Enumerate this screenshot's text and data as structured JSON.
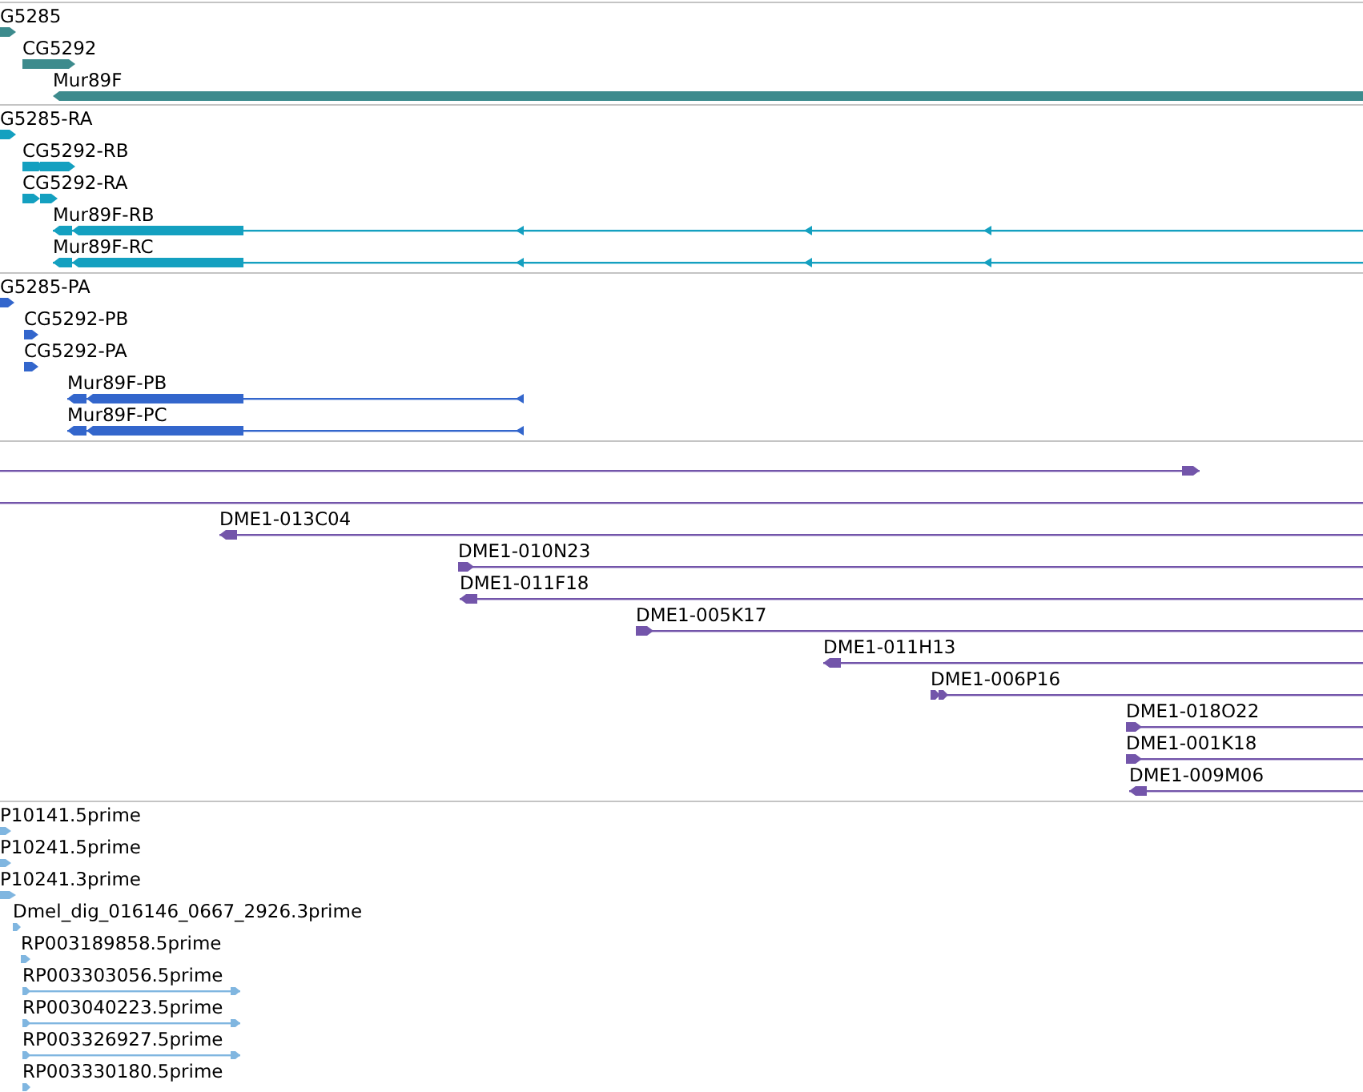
{
  "tracks": [
    {
      "color": "#3d8b8d",
      "features": [
        {
          "label": "G5285",
          "reverse": false
        },
        {
          "label": "CG5292",
          "reverse": false
        },
        {
          "label": "Mur89F",
          "reverse": true
        }
      ]
    },
    {
      "color": "#14a0c0",
      "features": [
        {
          "label": "G5285-RA",
          "reverse": false
        },
        {
          "label": "CG5292-RB",
          "reverse": false
        },
        {
          "label": "CG5292-RA",
          "reverse": false
        },
        {
          "label": "Mur89F-RB",
          "reverse": true
        },
        {
          "label": "Mur89F-RC",
          "reverse": true
        }
      ]
    },
    {
      "color": "#3366cc",
      "features": [
        {
          "label": "G5285-PA",
          "reverse": false
        },
        {
          "label": "CG5292-PB",
          "reverse": false
        },
        {
          "label": "CG5292-PA",
          "reverse": false
        },
        {
          "label": "Mur89F-PB",
          "reverse": true
        },
        {
          "label": "Mur89F-PC",
          "reverse": true
        }
      ]
    },
    {
      "color": "#7355aa",
      "features": [
        {
          "reverse": false
        },
        {
          "reverse": false
        },
        {
          "label": "DME1-013C04",
          "reverse": true
        },
        {
          "label": "DME1-010N23",
          "reverse": false
        },
        {
          "label": "DME1-011F18",
          "reverse": true
        },
        {
          "label": "DME1-005K17",
          "reverse": false
        },
        {
          "label": "DME1-011H13",
          "reverse": true
        },
        {
          "label": "DME1-006P16",
          "reverse": false
        },
        {
          "label": "DME1-018O22",
          "reverse": false
        },
        {
          "label": "DME1-001K18",
          "reverse": false
        },
        {
          "label": "DME1-009M06",
          "reverse": true
        }
      ]
    },
    {
      "color": "#80b6e0",
      "features": [
        {
          "label": "P10141.5prime",
          "reverse": false
        },
        {
          "label": "P10241.5prime",
          "reverse": false
        },
        {
          "label": "P10241.3prime",
          "reverse": false
        },
        {
          "label": "Dmel_dig_016146_0667_2926.3prime",
          "reverse": false
        },
        {
          "label": "RP003189858.5prime",
          "reverse": false
        },
        {
          "label": "RP003303056.5prime",
          "reverse": false
        },
        {
          "label": "RP003040223.5prime",
          "reverse": false
        },
        {
          "label": "RP003326927.5prime",
          "reverse": false
        },
        {
          "label": "RP003330180.5prime",
          "reverse": false
        }
      ]
    }
  ]
}
